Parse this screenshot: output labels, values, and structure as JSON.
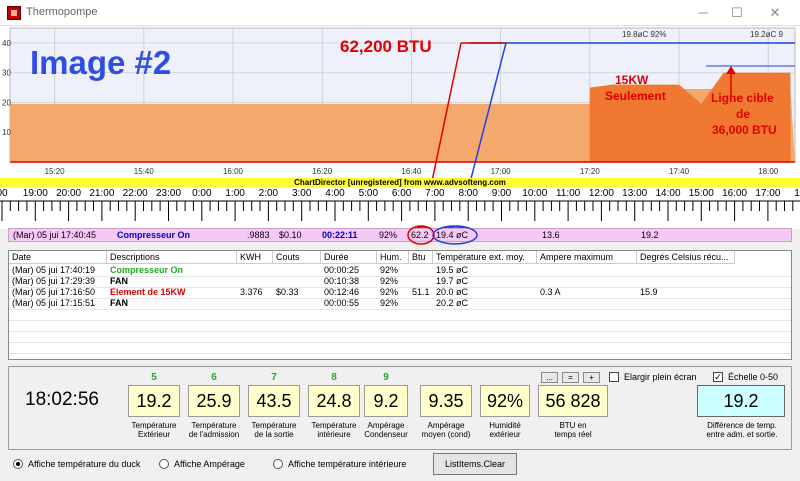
{
  "window": {
    "title": "Thermopompe",
    "min": "─",
    "max": "☐",
    "close": "✕"
  },
  "chart": {
    "watermark": "Image #2",
    "btu_annotation": "62,200 BTU",
    "kw_annotation_line1": "15KW",
    "kw_annotation_line2": "Seulement",
    "target_line1": "Ligne cible",
    "target_line2": "de",
    "target_line3": "36,000 BTU",
    "top_label_1": "19.8øC 92%",
    "top_label_2": "19.2øC 9",
    "y_ticks": [
      "40",
      "30",
      "20",
      "10"
    ],
    "x_ticks": [
      "15:20",
      "15:40",
      "16:00",
      "16:20",
      "16:40",
      "17:00",
      "17:20",
      "17:40",
      "18:00"
    ],
    "fill_color": "#f5a86b",
    "area_color": "#f07830",
    "line_color": "#2040e0",
    "red_color": "#e00000"
  },
  "chart_data": {
    "type": "area",
    "x": [
      "15:10",
      "15:20",
      "15:40",
      "16:00",
      "16:20",
      "16:40",
      "17:00",
      "17:10",
      "17:20",
      "17:25",
      "17:30",
      "17:35",
      "17:40",
      "17:45",
      "17:50",
      "17:55",
      "18:00",
      "18:05"
    ],
    "series": [
      {
        "values": [
          19.5,
          19.5,
          19.5,
          19.5,
          19.5,
          19.5,
          19.5,
          19.5,
          19.5,
          24,
          24.5,
          24.5,
          24.5,
          24.5,
          24.5,
          24,
          24,
          24
        ]
      },
      {
        "values": [
          null,
          null,
          null,
          null,
          null,
          null,
          null,
          null,
          25,
          26,
          26,
          26,
          26,
          19.5,
          30,
          30,
          30,
          30
        ]
      }
    ],
    "ylim": [
      0,
      45
    ],
    "xlabel": "",
    "ylabel": ""
  },
  "chartdirector": "ChartDirector [unregistered] from www.advsofteng.com",
  "timeline": {
    "hours": [
      "00",
      "19:00",
      "20:00",
      "21:00",
      "22:00",
      "23:00",
      "0:00",
      "1:00",
      "2:00",
      "3:00",
      "4:00",
      "5:00",
      "6:00",
      "7:00",
      "8:00",
      "9:00",
      "10:00",
      "11:00",
      "12:00",
      "13:00",
      "14:00",
      "15:00",
      "16:00",
      "17:00",
      "18:"
    ]
  },
  "current": {
    "date": "(Mar) 05 jui 17:40:45",
    "desc": "Compresseur On",
    "kwh": ".9883",
    "cost": "$0.10",
    "dur": "00:22:11",
    "hum": "92%",
    "btu": "62.2",
    "temp": "19.4 øC",
    "amp": "13.6",
    "deg": "19.2"
  },
  "table": {
    "headers": [
      "Date",
      "Descriptions",
      "KWH",
      "Couts",
      "Durée",
      "Hum.",
      "Btu",
      "Température ext. moy.",
      "Ampere maximum",
      "Degrés Celsius récu..."
    ],
    "rows": [
      {
        "date": "(Mar) 05 jui 17:40:19",
        "desc": "Compresseur On",
        "kwh": "",
        "cost": "",
        "dur": "00:00:25",
        "hum": "92%",
        "btu": "",
        "temp": "19.5 øC",
        "amp": "",
        "deg": ""
      },
      {
        "date": "(Mar) 05 jui 17:29:39",
        "desc": "FAN",
        "kwh": "",
        "cost": "",
        "dur": "00:10:38",
        "hum": "92%",
        "btu": "",
        "temp": "19.7 øC",
        "amp": "",
        "deg": ""
      },
      {
        "date": "(Mar) 05 jui 17:16:50",
        "desc": "Element de 15KW",
        "kwh": "3.376",
        "cost": "$0.33",
        "dur": "00:12:46",
        "hum": "92%",
        "btu": "51.1",
        "temp": "20.0 øC",
        "amp": "0.3 A",
        "deg": "15.9"
      },
      {
        "date": "(Mar) 05 jui 17:15:51",
        "desc": "FAN",
        "kwh": "",
        "cost": "",
        "dur": "00:00:55",
        "hum": "92%",
        "btu": "",
        "temp": "20.2 øC",
        "amp": "",
        "deg": ""
      }
    ]
  },
  "panel": {
    "clock": "18:02:56",
    "gauges": [
      {
        "num": "5",
        "value": "19.2",
        "label": "Température\nExtérieur"
      },
      {
        "num": "6",
        "value": "25.9",
        "label": "Température\nde l'admission"
      },
      {
        "num": "7",
        "value": "43.5",
        "label": "Température\nde la sortie"
      },
      {
        "num": "8",
        "value": "24.8",
        "label": "Température\nintérieure"
      },
      {
        "num": "9",
        "value": "9.2",
        "label": "Ampérage\nCondenseur"
      },
      {
        "num": "",
        "value": "9.35",
        "label": "Ampérage\nmoyen (cond)"
      },
      {
        "num": "",
        "value": "92%",
        "label": "Humidité\nextérieur"
      },
      {
        "num": "",
        "value": "56 828",
        "label": "BTU en\ntemps réel"
      }
    ],
    "btn_minus": "...",
    "btn_equal": "=",
    "btn_plus": "+",
    "elargir": "Elargir plein écran",
    "echelle": "Échelle 0-50",
    "echelle_checked": "✓",
    "diff_value": "19.2",
    "diff_label": "Différence de temp.\nentre adm. et sortie."
  },
  "radios": {
    "r1": "Affiche température du duck",
    "r2": "Affiche Ampérage",
    "r3": "Affiche température intérieure",
    "clear": "ListItems.Clear"
  }
}
